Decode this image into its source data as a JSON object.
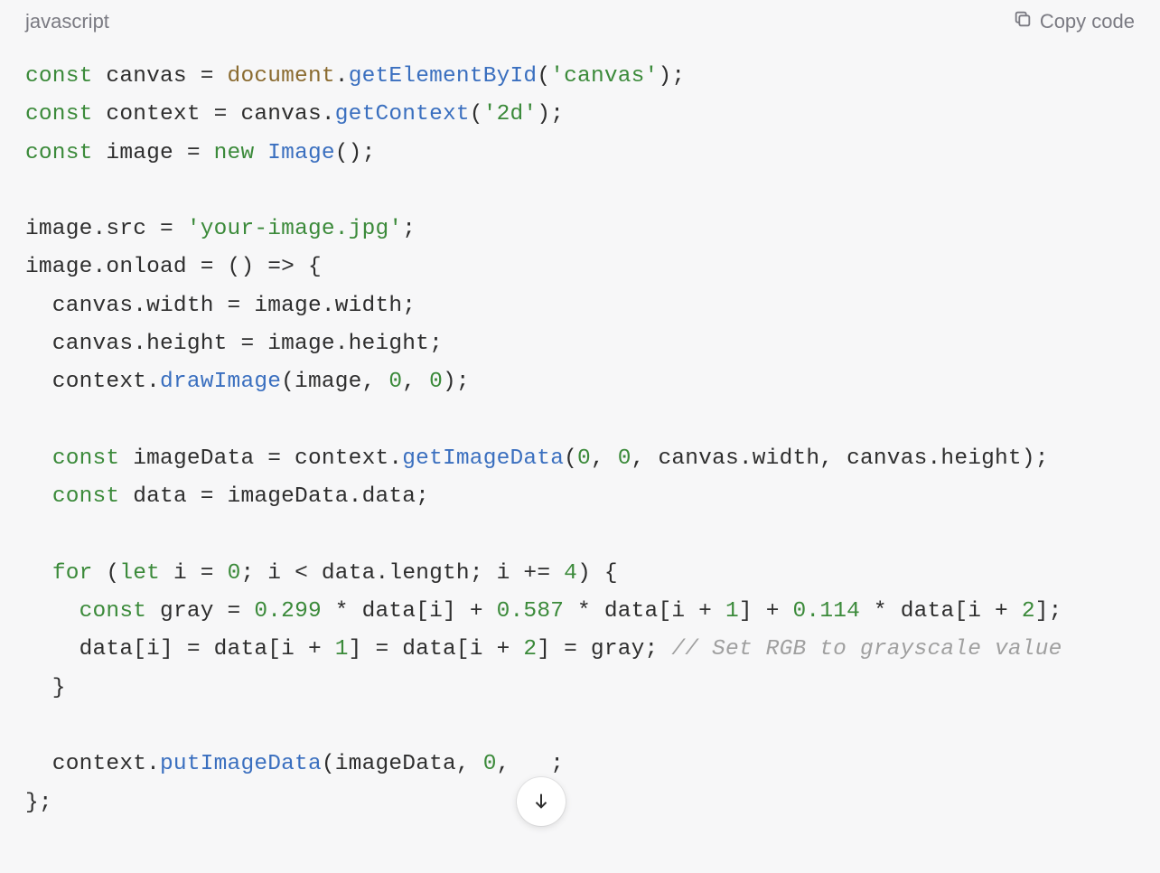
{
  "header": {
    "language": "javascript",
    "copy_label": "Copy code"
  },
  "code": {
    "l1": {
      "a": "const",
      "b": " canvas = ",
      "c": "document",
      "d": ".",
      "e": "getElementById",
      "f": "(",
      "g": "'canvas'",
      "h": ");"
    },
    "l2": {
      "a": "const",
      "b": " context = canvas.",
      "c": "getContext",
      "d": "(",
      "e": "'2d'",
      "f": ");"
    },
    "l3": {
      "a": "const",
      "b": " image = ",
      "c": "new",
      "d": " ",
      "e": "Image",
      "f": "();"
    },
    "l5": {
      "a": "image.src = ",
      "b": "'your-image.jpg'",
      "c": ";"
    },
    "l6": {
      "a": "image.onload = () => {"
    },
    "l7": {
      "a": "  canvas.width = image.width;"
    },
    "l8": {
      "a": "  canvas.height = image.height;"
    },
    "l9": {
      "a": "  context.",
      "b": "drawImage",
      "c": "(image, ",
      "d": "0",
      "e": ", ",
      "f": "0",
      "g": ");"
    },
    "l11": {
      "a": "  ",
      "b": "const",
      "c": " imageData = context.",
      "d": "getImageData",
      "e": "(",
      "f": "0",
      "g": ", ",
      "h": "0",
      "i": ", canvas.width, canvas.height);"
    },
    "l12": {
      "a": "  ",
      "b": "const",
      "c": " data = imageData.data;"
    },
    "l14": {
      "a": "  ",
      "b": "for",
      "c": " (",
      "d": "let",
      "e": " i = ",
      "f": "0",
      "g": "; i < data.length; i += ",
      "h": "4",
      "i": ") {"
    },
    "l15": {
      "a": "    ",
      "b": "const",
      "c": " gray = ",
      "d": "0.299",
      "e": " * data[i] + ",
      "f": "0.587",
      "g": " * data[i + ",
      "h": "1",
      "i": "] + ",
      "j": "0.114",
      "k": " * data[i + ",
      "l": "2",
      "m": "];"
    },
    "l16": {
      "a": "    data[i] = data[i + ",
      "b": "1",
      "c": "] = data[i + ",
      "d": "2",
      "e": "] = gray; ",
      "f": "// Set RGB to grayscale value"
    },
    "l17": {
      "a": "  }"
    },
    "l19": {
      "a": "  context.",
      "b": "putImageData",
      "c": "(imageData, ",
      "d": "0",
      "e": ",   ;"
    },
    "l20": {
      "a": "};"
    }
  }
}
